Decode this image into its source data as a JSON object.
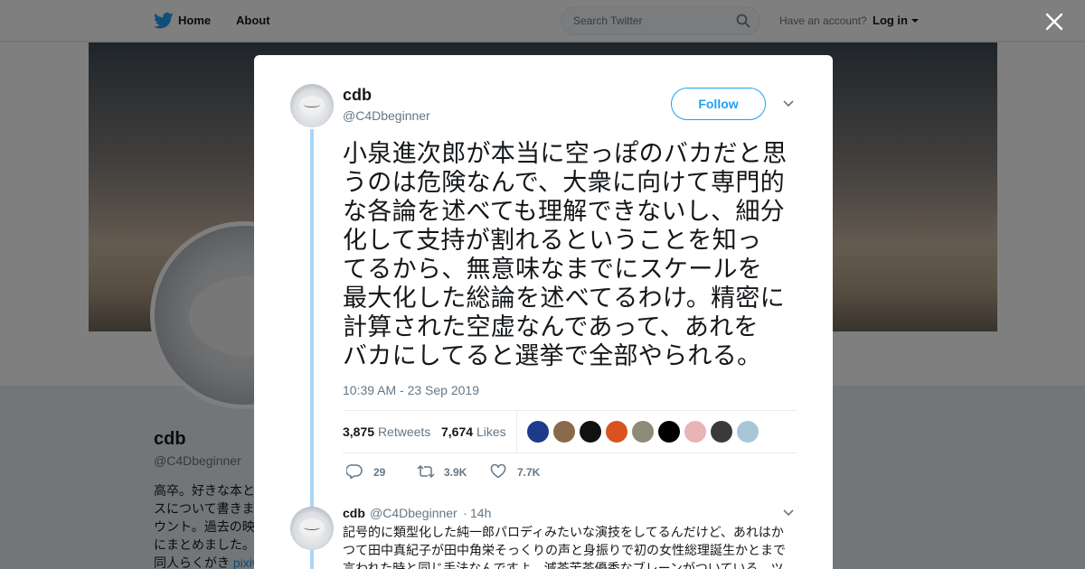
{
  "nav": {
    "home_label": "Home",
    "about_label": "About",
    "search_placeholder": "Search Twitter",
    "account_question": "Have an account?",
    "login_label": "Log in"
  },
  "profile": {
    "name": "cdb",
    "handle": "@C4Dbeginner",
    "bio_lines": [
      "高卒。好きな本と",
      "スについて書きま",
      "ウント。過去の映",
      "にまとめました。"
    ],
    "bio_last_prefix": "同人らくがき",
    "bio_link": "pixiv"
  },
  "tweet": {
    "name": "cdb",
    "handle": "@C4Dbeginner",
    "follow_label": "Follow",
    "text_lines": [
      "小泉進次郎が本当に空っぽのバカだと思",
      "うのは危険なんで、大衆に向けて専門的",
      "な各論を述べても理解できないし、細分",
      "化して支持が割れるということを知っ",
      "てるから、無意味なまでにスケールを",
      "最大化した総論を述べてるわけ。精密に",
      "計算された空虚なんであって、あれを",
      "バカにしてると選挙で全部やられる。"
    ],
    "timestamp": "10:39 AM - 23 Sep 2019",
    "retweets_count": "3,875",
    "retweets_label": "Retweets",
    "likes_count": "7,674",
    "likes_label": "Likes",
    "reply_count": "29",
    "retweet_action_count": "3.9K",
    "like_action_count": "7.7K"
  },
  "reply": {
    "name": "cdb",
    "handle": "@C4Dbeginner",
    "separator": "·",
    "time": "14h",
    "text_lines": [
      "記号的に類型化した純一郎パロディみたいな演技をしてるんだけど、あれはか",
      "つて田中真紀子が田中角栄そっくりの声と身振りで初の女性総理誕生かとまで",
      "言われた時と同じ手法なんですよ。滅茶苦茶優秀なブレーンがついている。ツ"
    ]
  },
  "colors": {
    "accent": "#1da1f2",
    "thread_line": "#a8d6f5",
    "muted_text": "#657786"
  },
  "icons": [
    "twitter-bird-icon",
    "search-icon",
    "close-icon",
    "chevron-down-icon",
    "reply-icon",
    "retweet-icon",
    "heart-icon"
  ]
}
